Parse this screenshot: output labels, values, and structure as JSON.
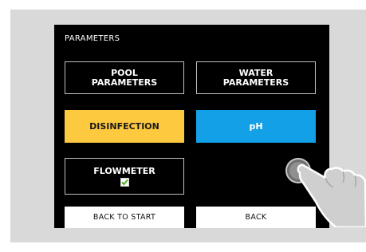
{
  "screen": {
    "title": "PARAMETERS",
    "buttons": {
      "pool_parameters": "POOL\nPARAMETERS",
      "water_parameters": "WATER\nPARAMETERS",
      "disinfection": "DISINFECTION",
      "ph": "pH",
      "flowmeter": "FLOWMETER",
      "back_to_start": "BACK TO START",
      "back": "BACK"
    },
    "flowmeter_checked": true
  },
  "colors": {
    "screen_bg": "#000000",
    "disinfection": "#fdc93f",
    "ph": "#14a0e6",
    "check_green": "#4caf2a"
  }
}
